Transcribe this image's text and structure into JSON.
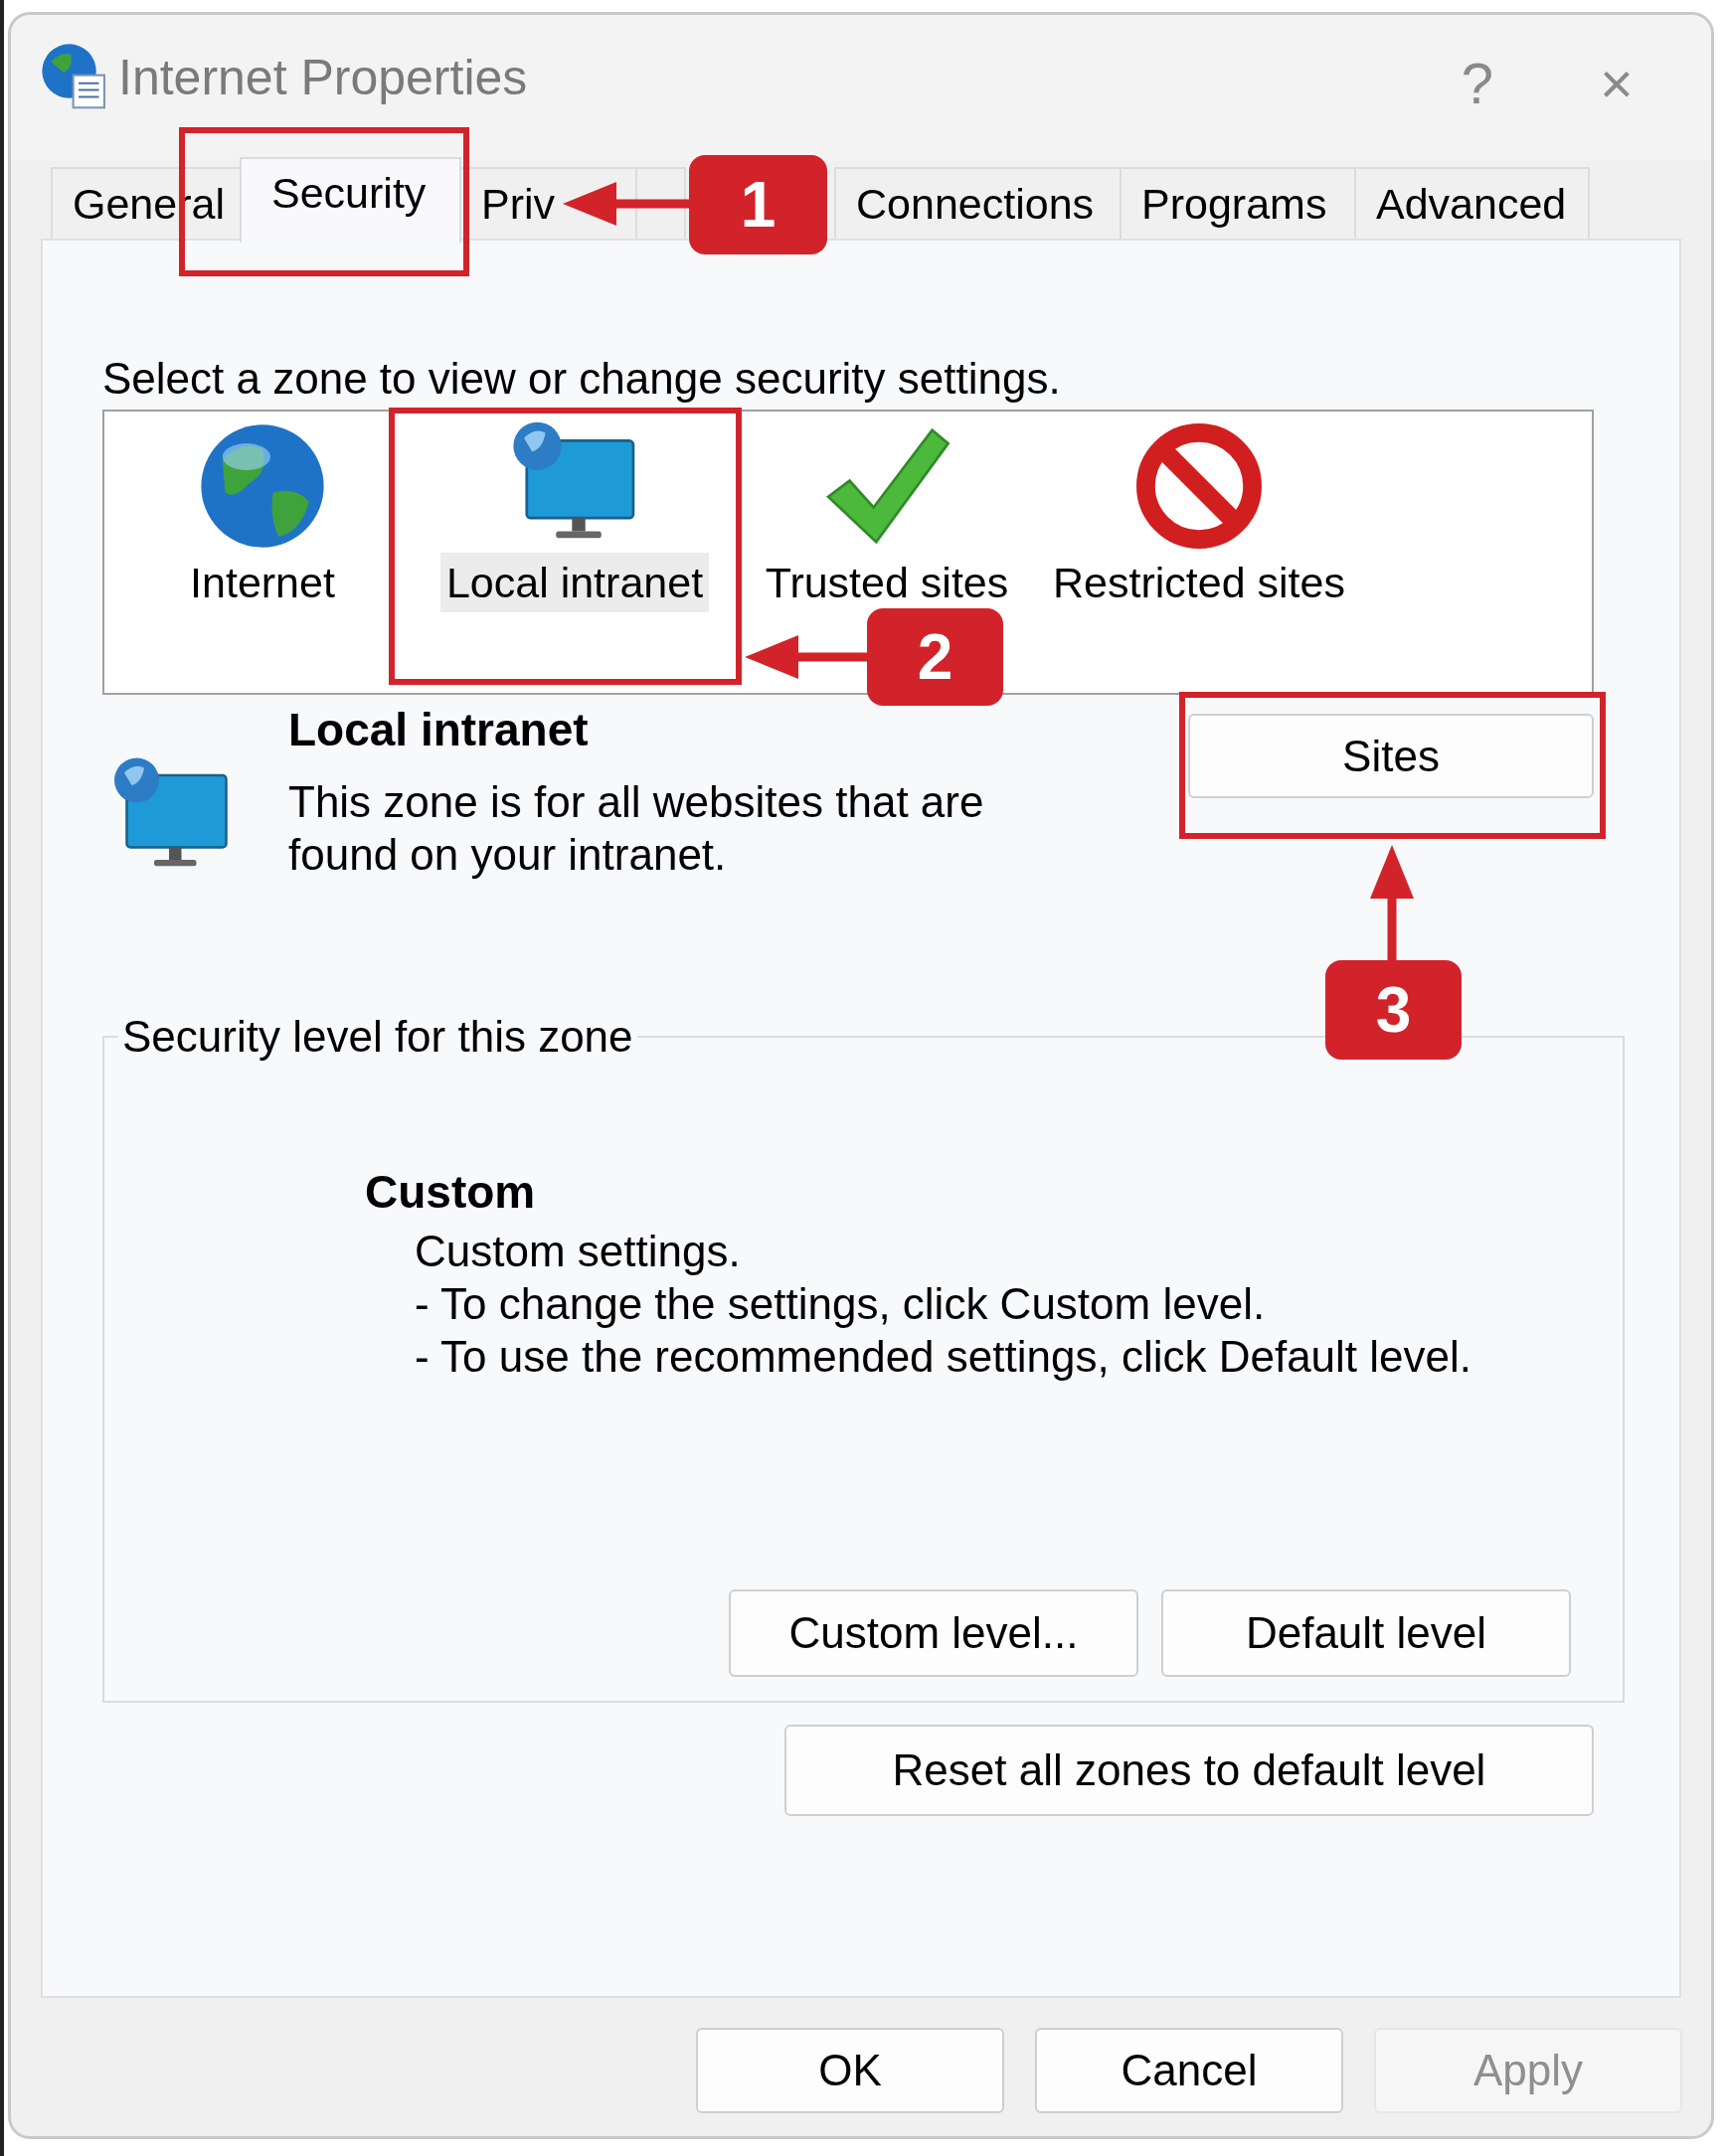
{
  "window": {
    "title": "Internet Properties",
    "help": "?",
    "close": "×"
  },
  "tabs": [
    {
      "label": "General",
      "selected": false
    },
    {
      "label": "Security",
      "selected": true
    },
    {
      "label": "Priv",
      "selected": false
    },
    {
      "selected": false
    },
    {
      "label": "Connections",
      "selected": false
    },
    {
      "label": "Programs",
      "selected": false
    },
    {
      "label": "Advanced",
      "selected": false
    }
  ],
  "zone_prompt": "Select a zone to view or change security settings.",
  "zones": [
    {
      "kind": "internet",
      "label": "Internet",
      "selected": false
    },
    {
      "kind": "intranet",
      "label": "Local intranet",
      "selected": true
    },
    {
      "kind": "trusted",
      "label": "Trusted sites",
      "selected": false
    },
    {
      "kind": "restricted",
      "label": "Restricted sites",
      "selected": false
    }
  ],
  "zone_detail": {
    "kind": "intranet",
    "title": "Local intranet",
    "description": "This zone is for all websites that are found on your intranet.",
    "button": "Sites"
  },
  "security_level": {
    "legend": "Security level for this zone",
    "level_name": "Custom",
    "lines": [
      "Custom settings.",
      "- To change the settings, click Custom level.",
      "- To use the recommended settings, click Default level."
    ],
    "buttons": [
      "Custom level...",
      "Default level"
    ]
  },
  "reset_button": "Reset all zones to default level",
  "footer_buttons": [
    {
      "label": "OK",
      "disabled": false
    },
    {
      "label": "Cancel",
      "disabled": false
    },
    {
      "label": "Apply",
      "disabled": true
    }
  ],
  "annotations": [
    {
      "label": "1"
    },
    {
      "label": "2"
    },
    {
      "label": "3"
    }
  ]
}
